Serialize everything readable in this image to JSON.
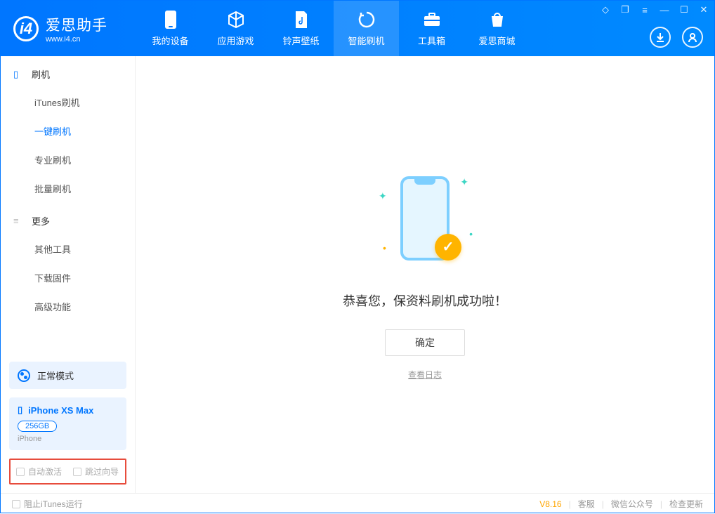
{
  "app": {
    "title": "爱思助手",
    "subtitle": "www.i4.cn"
  },
  "tabs": {
    "device": "我的设备",
    "apps": "应用游戏",
    "ringtones": "铃声壁纸",
    "flash": "智能刷机",
    "toolbox": "工具箱",
    "store": "爱思商城"
  },
  "sidebar": {
    "group_flash": "刷机",
    "items_flash": {
      "itunes": "iTunes刷机",
      "oneclick": "一键刷机",
      "pro": "专业刷机",
      "batch": "批量刷机"
    },
    "group_more": "更多",
    "items_more": {
      "other": "其他工具",
      "firmware": "下载固件",
      "advanced": "高级功能"
    }
  },
  "mode": {
    "label": "正常模式"
  },
  "device": {
    "name": "iPhone XS Max",
    "storage": "256GB",
    "type": "iPhone"
  },
  "options": {
    "auto_activate": "自动激活",
    "skip_guide": "跳过向导"
  },
  "main": {
    "success_title": "恭喜您，保资料刷机成功啦！",
    "confirm": "确定",
    "view_log": "查看日志"
  },
  "footer": {
    "block_itunes": "阻止iTunes运行",
    "version": "V8.16",
    "support": "客服",
    "wechat": "微信公众号",
    "update": "检查更新"
  }
}
